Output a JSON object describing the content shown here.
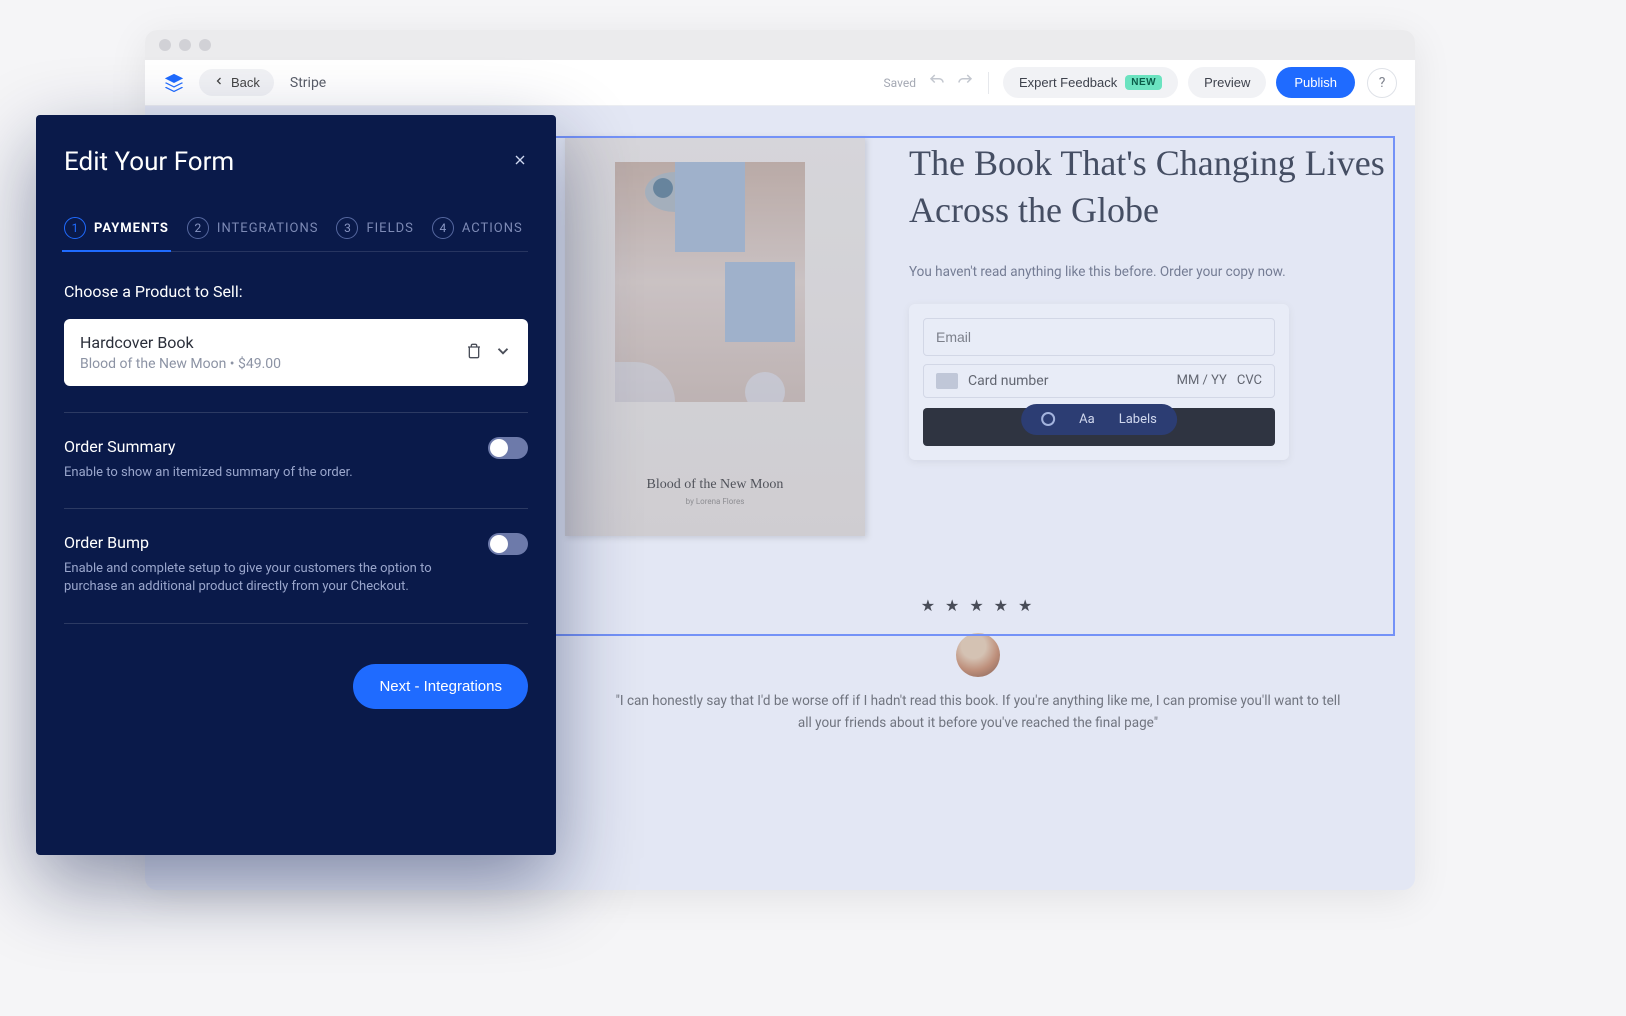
{
  "toolbar": {
    "back_label": "Back",
    "breadcrumb": "Stripe",
    "saved_label": "Saved",
    "expert_feedback_label": "Expert Feedback",
    "new_badge": "NEW",
    "preview_label": "Preview",
    "publish_label": "Publish",
    "help_label": "?"
  },
  "panel": {
    "title": "Edit Your Form",
    "tabs": [
      {
        "num": "1",
        "label": "PAYMENTS",
        "active": true
      },
      {
        "num": "2",
        "label": "INTEGRATIONS",
        "active": false
      },
      {
        "num": "3",
        "label": "FIELDS",
        "active": false
      },
      {
        "num": "4",
        "label": "ACTIONS",
        "active": false
      }
    ],
    "choose_label": "Choose a Product to Sell:",
    "product": {
      "title": "Hardcover Book",
      "subtitle": "Blood of the New Moon • $49.00"
    },
    "order_summary": {
      "title": "Order Summary",
      "desc": "Enable to show an itemized summary of the order."
    },
    "order_bump": {
      "title": "Order Bump",
      "desc": "Enable and complete setup to give your customers the option to purchase an additional product directly from your Checkout."
    },
    "next_label": "Next - Integrations"
  },
  "page": {
    "hero_title": "The Book That's Changing Lives Across the Globe",
    "hero_sub": "You haven't read anything like this before. Order your copy now.",
    "book_title": "Blood of the New Moon",
    "book_author": "by Lorena Flores",
    "form": {
      "email_placeholder": "Email",
      "card_label": "Card number",
      "expiry_label": "MM / YY",
      "cvc_label": "CVC",
      "pill_aa": "Aa",
      "pill_labels": "Labels"
    },
    "testimonial": {
      "stars": "★ ★ ★ ★ ★",
      "quote": "\"I can honestly say that I'd be worse off if I hadn't read this book. If you're anything like me, I can promise you'll want to tell all your friends about it before you've reached the final page\""
    }
  }
}
